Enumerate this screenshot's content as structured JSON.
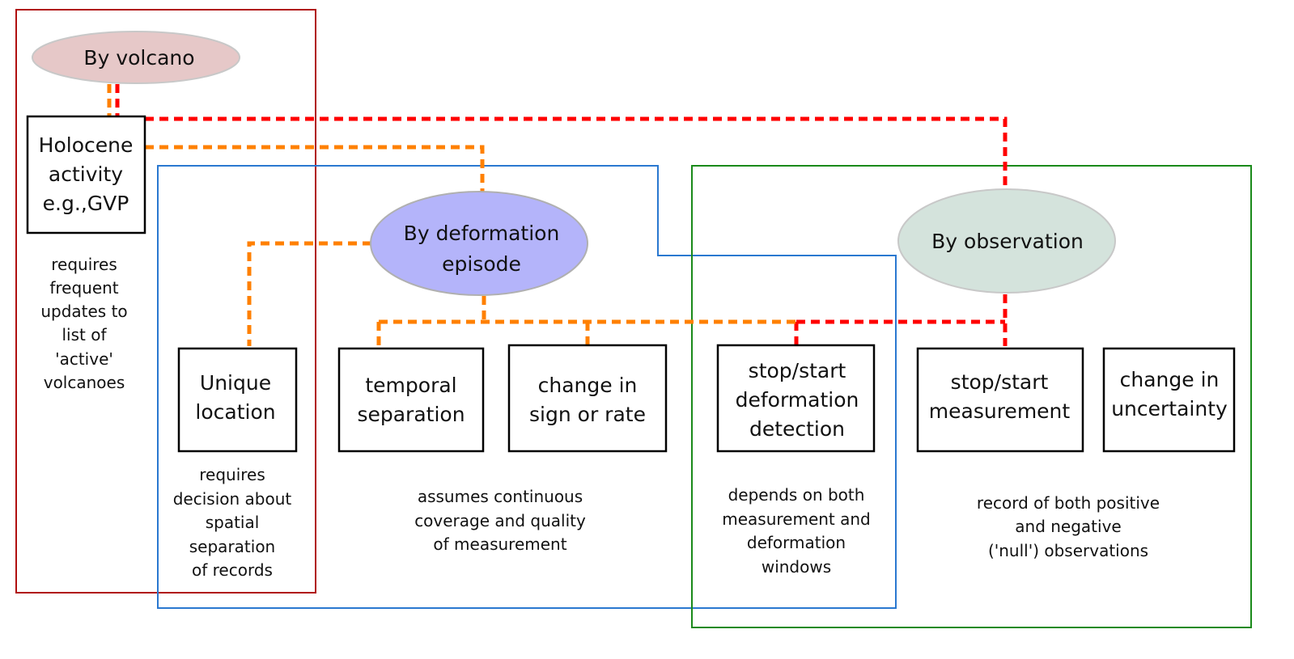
{
  "colors": {
    "volcano_group": "#b01010",
    "episode_group": "#2a78d0",
    "observation_group": "#1a8a1a",
    "volcano_fill": "#e6c8c8",
    "episode_fill": "#b4b4fa",
    "observation_fill": "#d4e3dc",
    "red_link": "#ff0000",
    "orange_link": "#ff8000"
  },
  "nodes": {
    "by_volcano": "By volcano",
    "by_episode": [
      "By deformation",
      "episode"
    ],
    "by_observation": "By observation",
    "holocene": [
      "Holocene",
      "activity",
      "e.g.,GVP"
    ],
    "unique_location": [
      "Unique",
      "location"
    ],
    "temporal_separation": [
      "temporal",
      "separation"
    ],
    "change_sign_rate": [
      "change in",
      "sign or rate"
    ],
    "stop_start_detection": [
      "stop/start",
      "deformation",
      "detection"
    ],
    "stop_start_measurement": [
      "stop/start",
      "measurement"
    ],
    "change_uncertainty": [
      "change in",
      "uncertainty"
    ]
  },
  "notes": {
    "volcano": [
      "requires",
      "frequent",
      "updates to",
      "list of",
      "'active'",
      "volcanoes"
    ],
    "location": [
      "requires",
      "decision about",
      "spatial",
      "separation",
      "of records"
    ],
    "continuous": [
      "assumes continuous",
      "coverage and quality",
      "of measurement"
    ],
    "depends": [
      "depends on both",
      "measurement and",
      "deformation",
      "windows"
    ],
    "record": [
      "record of both positive",
      "and negative",
      "('null') observations"
    ]
  }
}
